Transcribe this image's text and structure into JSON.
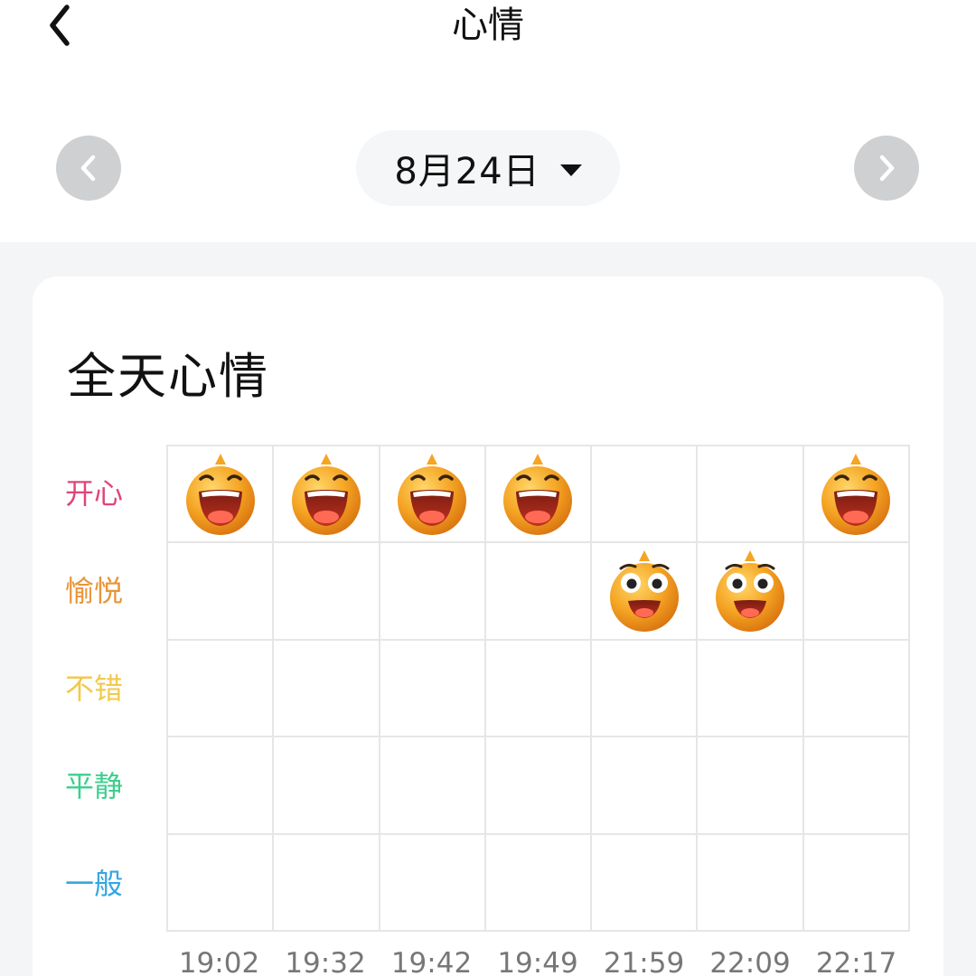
{
  "header": {
    "title": "心情"
  },
  "date_picker": {
    "label": "8月24日"
  },
  "card": {
    "title": "全天心情"
  },
  "moods": [
    {
      "label": "开心",
      "color": "#e0457b"
    },
    {
      "label": "愉悦",
      "color": "#e8953a"
    },
    {
      "label": "不错",
      "color": "#f2c94c"
    },
    {
      "label": "平静",
      "color": "#3ccf8e"
    },
    {
      "label": "一般",
      "color": "#35a6e0"
    }
  ],
  "times": [
    "19:02",
    "19:32",
    "19:42",
    "19:49",
    "21:59",
    "22:09",
    "22:17"
  ],
  "entries": [
    {
      "time": "19:02",
      "mood": "开心",
      "icon": "laughing-face-icon"
    },
    {
      "time": "19:32",
      "mood": "开心",
      "icon": "laughing-face-icon"
    },
    {
      "time": "19:42",
      "mood": "开心",
      "icon": "laughing-face-icon"
    },
    {
      "time": "19:49",
      "mood": "开心",
      "icon": "laughing-face-icon"
    },
    {
      "time": "21:59",
      "mood": "愉悦",
      "icon": "smiling-face-icon"
    },
    {
      "time": "22:09",
      "mood": "愉悦",
      "icon": "smiling-face-icon"
    },
    {
      "time": "22:17",
      "mood": "开心",
      "icon": "laughing-face-icon"
    }
  ]
}
